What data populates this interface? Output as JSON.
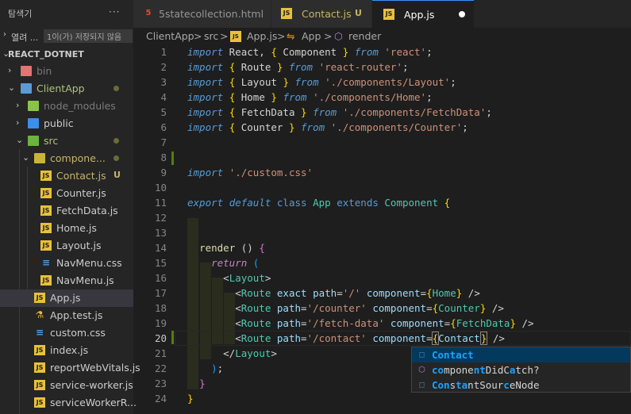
{
  "sidebar": {
    "title": "탐색기",
    "more": "···",
    "open_editors": {
      "label": "열려 ...",
      "badge": "1이(가) 저장되지 않음"
    },
    "project": "REACT_DOTNET",
    "items": [
      {
        "label": "bin"
      },
      {
        "label": "ClientApp"
      },
      {
        "label": "node_modules"
      },
      {
        "label": "public"
      },
      {
        "label": "src"
      },
      {
        "label": "compone..."
      },
      {
        "label": "Contact.js",
        "badge": "U"
      },
      {
        "label": "Counter.js"
      },
      {
        "label": "FetchData.js"
      },
      {
        "label": "Home.js"
      },
      {
        "label": "Layout.js"
      },
      {
        "label": "NavMenu.css"
      },
      {
        "label": "NavMenu.js"
      },
      {
        "label": "App.js"
      },
      {
        "label": "App.test.js"
      },
      {
        "label": "custom.css"
      },
      {
        "label": "index.js"
      },
      {
        "label": "reportWebVitals.js"
      },
      {
        "label": "service-worker.js"
      },
      {
        "label": "serviceWorkerR..."
      }
    ]
  },
  "tabs": [
    {
      "label": "5statecollection.html",
      "icon": "html5-icon"
    },
    {
      "label": "Contact.js",
      "badge": "U",
      "icon": "js-icon"
    },
    {
      "label": "App.js",
      "icon": "js-icon",
      "active": true,
      "dirty": true
    }
  ],
  "breadcrumb": [
    "ClientApp",
    ">",
    "src",
    ">",
    "App.js",
    ">",
    "App",
    ">",
    "render"
  ],
  "editor": {
    "line_numbers": [
      "1",
      "2",
      "3",
      "4",
      "5",
      "6",
      "7",
      "8",
      "9",
      "10",
      "11",
      "12",
      "13",
      "14",
      "15",
      "16",
      "17",
      "18",
      "19",
      "20",
      "21",
      "22",
      "23",
      "24"
    ],
    "current_line": 20,
    "modified_lines": [
      8,
      20
    ]
  },
  "suggest": {
    "items": [
      {
        "label": "Contact",
        "match": "Contact",
        "rest": "",
        "icon": "symbol-reference-icon"
      },
      {
        "label": "componentDidCatch?",
        "icon": "method-icon"
      },
      {
        "label": "ConstantSourceNode",
        "icon": "class-icon"
      }
    ]
  },
  "colors": {
    "accent": "#3794ff",
    "background": "#1e1e1e",
    "sidebar": "#252526",
    "modified": "#587c0c",
    "untracked": "#c5b56a"
  }
}
